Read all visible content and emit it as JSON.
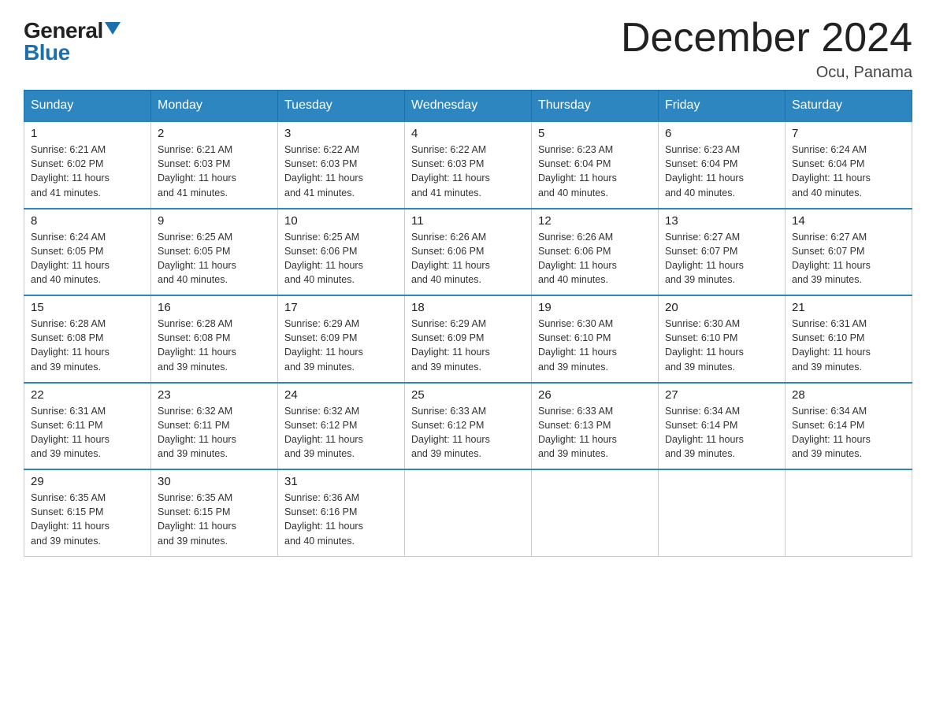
{
  "logo": {
    "text_general": "General",
    "text_blue": "Blue",
    "triangle_symbol": "▲"
  },
  "header": {
    "title": "December 2024",
    "subtitle": "Ocu, Panama"
  },
  "calendar": {
    "days_of_week": [
      "Sunday",
      "Monday",
      "Tuesday",
      "Wednesday",
      "Thursday",
      "Friday",
      "Saturday"
    ],
    "weeks": [
      [
        {
          "day": "1",
          "sunrise": "6:21 AM",
          "sunset": "6:02 PM",
          "daylight": "11 hours and 41 minutes."
        },
        {
          "day": "2",
          "sunrise": "6:21 AM",
          "sunset": "6:03 PM",
          "daylight": "11 hours and 41 minutes."
        },
        {
          "day": "3",
          "sunrise": "6:22 AM",
          "sunset": "6:03 PM",
          "daylight": "11 hours and 41 minutes."
        },
        {
          "day": "4",
          "sunrise": "6:22 AM",
          "sunset": "6:03 PM",
          "daylight": "11 hours and 41 minutes."
        },
        {
          "day": "5",
          "sunrise": "6:23 AM",
          "sunset": "6:04 PM",
          "daylight": "11 hours and 40 minutes."
        },
        {
          "day": "6",
          "sunrise": "6:23 AM",
          "sunset": "6:04 PM",
          "daylight": "11 hours and 40 minutes."
        },
        {
          "day": "7",
          "sunrise": "6:24 AM",
          "sunset": "6:04 PM",
          "daylight": "11 hours and 40 minutes."
        }
      ],
      [
        {
          "day": "8",
          "sunrise": "6:24 AM",
          "sunset": "6:05 PM",
          "daylight": "11 hours and 40 minutes."
        },
        {
          "day": "9",
          "sunrise": "6:25 AM",
          "sunset": "6:05 PM",
          "daylight": "11 hours and 40 minutes."
        },
        {
          "day": "10",
          "sunrise": "6:25 AM",
          "sunset": "6:06 PM",
          "daylight": "11 hours and 40 minutes."
        },
        {
          "day": "11",
          "sunrise": "6:26 AM",
          "sunset": "6:06 PM",
          "daylight": "11 hours and 40 minutes."
        },
        {
          "day": "12",
          "sunrise": "6:26 AM",
          "sunset": "6:06 PM",
          "daylight": "11 hours and 40 minutes."
        },
        {
          "day": "13",
          "sunrise": "6:27 AM",
          "sunset": "6:07 PM",
          "daylight": "11 hours and 39 minutes."
        },
        {
          "day": "14",
          "sunrise": "6:27 AM",
          "sunset": "6:07 PM",
          "daylight": "11 hours and 39 minutes."
        }
      ],
      [
        {
          "day": "15",
          "sunrise": "6:28 AM",
          "sunset": "6:08 PM",
          "daylight": "11 hours and 39 minutes."
        },
        {
          "day": "16",
          "sunrise": "6:28 AM",
          "sunset": "6:08 PM",
          "daylight": "11 hours and 39 minutes."
        },
        {
          "day": "17",
          "sunrise": "6:29 AM",
          "sunset": "6:09 PM",
          "daylight": "11 hours and 39 minutes."
        },
        {
          "day": "18",
          "sunrise": "6:29 AM",
          "sunset": "6:09 PM",
          "daylight": "11 hours and 39 minutes."
        },
        {
          "day": "19",
          "sunrise": "6:30 AM",
          "sunset": "6:10 PM",
          "daylight": "11 hours and 39 minutes."
        },
        {
          "day": "20",
          "sunrise": "6:30 AM",
          "sunset": "6:10 PM",
          "daylight": "11 hours and 39 minutes."
        },
        {
          "day": "21",
          "sunrise": "6:31 AM",
          "sunset": "6:10 PM",
          "daylight": "11 hours and 39 minutes."
        }
      ],
      [
        {
          "day": "22",
          "sunrise": "6:31 AM",
          "sunset": "6:11 PM",
          "daylight": "11 hours and 39 minutes."
        },
        {
          "day": "23",
          "sunrise": "6:32 AM",
          "sunset": "6:11 PM",
          "daylight": "11 hours and 39 minutes."
        },
        {
          "day": "24",
          "sunrise": "6:32 AM",
          "sunset": "6:12 PM",
          "daylight": "11 hours and 39 minutes."
        },
        {
          "day": "25",
          "sunrise": "6:33 AM",
          "sunset": "6:12 PM",
          "daylight": "11 hours and 39 minutes."
        },
        {
          "day": "26",
          "sunrise": "6:33 AM",
          "sunset": "6:13 PM",
          "daylight": "11 hours and 39 minutes."
        },
        {
          "day": "27",
          "sunrise": "6:34 AM",
          "sunset": "6:14 PM",
          "daylight": "11 hours and 39 minutes."
        },
        {
          "day": "28",
          "sunrise": "6:34 AM",
          "sunset": "6:14 PM",
          "daylight": "11 hours and 39 minutes."
        }
      ],
      [
        {
          "day": "29",
          "sunrise": "6:35 AM",
          "sunset": "6:15 PM",
          "daylight": "11 hours and 39 minutes."
        },
        {
          "day": "30",
          "sunrise": "6:35 AM",
          "sunset": "6:15 PM",
          "daylight": "11 hours and 39 minutes."
        },
        {
          "day": "31",
          "sunrise": "6:36 AM",
          "sunset": "6:16 PM",
          "daylight": "11 hours and 40 minutes."
        },
        null,
        null,
        null,
        null
      ]
    ],
    "labels": {
      "sunrise": "Sunrise:",
      "sunset": "Sunset:",
      "daylight": "Daylight:"
    }
  }
}
